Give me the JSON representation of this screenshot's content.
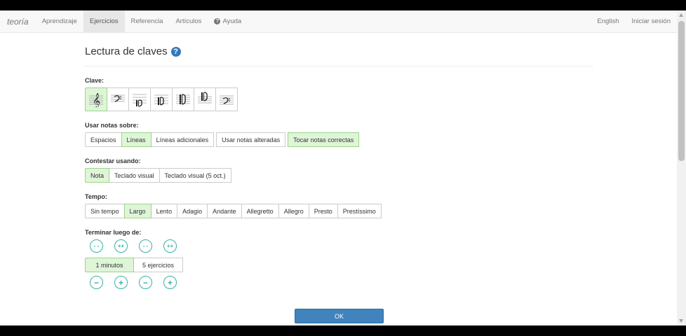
{
  "nav": {
    "brand": "teoría",
    "items": [
      "Aprendizaje",
      "Ejercicios",
      "Referencia",
      "Artículos",
      "Ayuda"
    ],
    "active_index": 1,
    "right": [
      "English",
      "Iniciar sesión"
    ]
  },
  "page": {
    "title": "Lectura de claves",
    "help_icon": "question-circle-icon"
  },
  "clave": {
    "label": "Clave:",
    "clefs": [
      "treble-clef-icon",
      "bass-clef-icon",
      "alto-clef-icon",
      "tenor-clef-icon",
      "mezzo-soprano-clef-icon",
      "soprano-clef-icon",
      "baritone-clef-icon"
    ],
    "selected_index": 0
  },
  "notas": {
    "label": "Usar notas sobre:",
    "options": [
      "Espacios",
      "Líneas",
      "Líneas adicionales",
      "Usar notas alteradas",
      "Tocar notas correctas"
    ],
    "selected": [
      1,
      4
    ]
  },
  "contestar": {
    "label": "Contestar usando:",
    "options": [
      "Nota",
      "Teclado visual",
      "Teclado visual (5 oct.)"
    ],
    "selected_index": 0
  },
  "tempo": {
    "label": "Tempo:",
    "options": [
      "Sin tempo",
      "Largo",
      "Lento",
      "Adagio",
      "Andante",
      "Allegretto",
      "Allegro",
      "Presto",
      "Prestíssimo"
    ],
    "selected_index": 1
  },
  "terminar": {
    "label": "Terminar luego de:",
    "top_buttons": [
      "- -",
      "++",
      "- -",
      "++"
    ],
    "minutes": "1 minutos",
    "exercises": "5 ejercicios",
    "bottom_buttons": [
      "−",
      "+",
      "−",
      "+"
    ]
  },
  "ok_label": "OK",
  "colors": {
    "selected_bg": "#dff5d8",
    "accent": "#38b0a8",
    "primary": "#4083bd"
  }
}
